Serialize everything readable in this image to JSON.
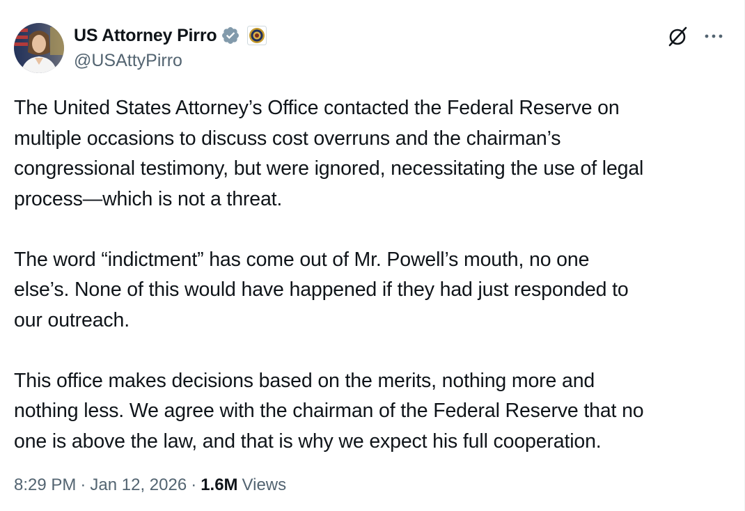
{
  "author": {
    "display_name": "US Attorney Pirro",
    "handle": "@USAttyPirro",
    "verified": true,
    "affiliation_badge": "seal-icon"
  },
  "icons": {
    "grok": "grok-icon",
    "more": "more-icon",
    "verified": "verified-badge-icon"
  },
  "tweet": {
    "paragraphs": [
      "The United States Attorney’s Office contacted the Federal Reserve on\nmultiple occasions to discuss cost overruns and the chairman’s\ncongressional testimony, but were ignored, necessitating the use of legal\nprocess—which is not a threat.",
      "The word “indictment” has come out of Mr. Powell’s mouth, no one\nelse’s. None of this would have happened if they had just responded to\nour outreach.",
      "This office makes decisions based on the merits, nothing more and\nnothing less. We agree with the chairman of the Federal Reserve that no\none is above the law, and that is why we expect his full cooperation."
    ]
  },
  "meta": {
    "time": "8:29 PM",
    "separator": "·",
    "date": "Jan 12, 2026",
    "views_count": "1.6M",
    "views_label": "Views"
  },
  "colors": {
    "text_primary": "#0f1419",
    "text_secondary": "#536471",
    "verified_badge": "#829aab",
    "background": "#ffffff"
  }
}
